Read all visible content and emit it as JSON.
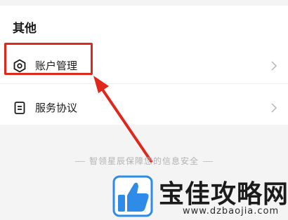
{
  "section": {
    "title": "其他"
  },
  "items": [
    {
      "label": "账户管理",
      "icon": "hexagon-settings-icon"
    },
    {
      "label": "服务协议",
      "icon": "document-icon"
    }
  ],
  "footer": {
    "note": "智领星辰保障您的信息安全"
  },
  "watermark": {
    "brand": "宝佳攻略网",
    "url": "www.dzbaojia.com"
  },
  "colors": {
    "highlight": "#e0271c",
    "panel": "#ffffff",
    "background": "#f4f4f4"
  }
}
